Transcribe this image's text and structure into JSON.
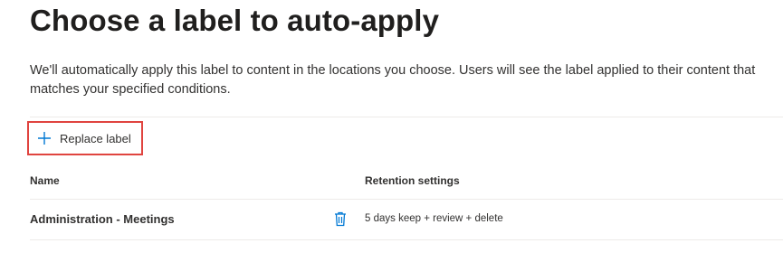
{
  "page": {
    "title": "Choose a label to auto-apply",
    "description": "We'll automatically apply this label to content in the locations you choose. Users will see the label applied to their content that matches your specified conditions."
  },
  "toolbar": {
    "replace_label": "Replace label",
    "replace_icon": "plus-icon"
  },
  "table": {
    "columns": [
      "Name",
      "Retention settings"
    ],
    "rows": [
      {
        "name": "Administration - Meetings",
        "retention": "5 days keep + review + delete",
        "action_icon": "trash-icon"
      }
    ]
  },
  "colors": {
    "accent": "#0078d4",
    "highlight_border": "#e0443f",
    "divider": "#edebe9"
  }
}
